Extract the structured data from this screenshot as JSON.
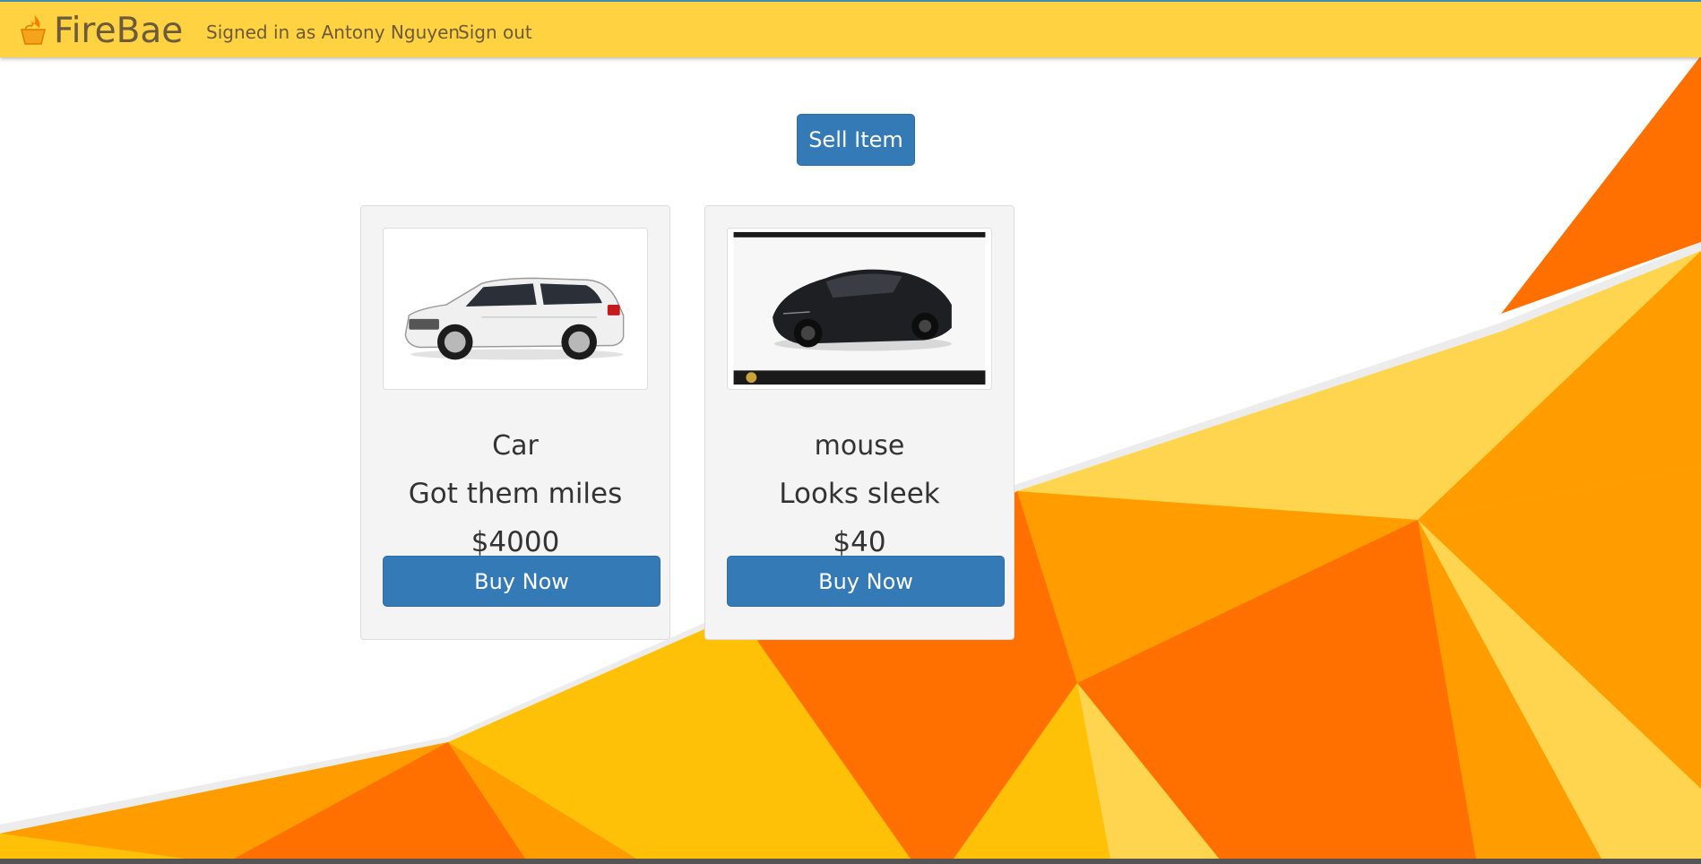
{
  "colors": {
    "navbar": "#ffd242",
    "navbar_border": "#3f8fb4",
    "button_primary": "#337ab7",
    "card_bg": "#f4f4f4",
    "poly_orange_dark": "#ff7000",
    "poly_orange": "#ff9d00",
    "poly_yellow": "#ffc107",
    "poly_yellow_light": "#ffd54f"
  },
  "navbar": {
    "brand": "FireBae",
    "brand_icon": "fire-basket-icon",
    "signed_in_text": "Signed in as Antony Nguyen",
    "signout_label": "Sign out"
  },
  "main": {
    "sell_button_label": "Sell Item"
  },
  "items": [
    {
      "image_icon": "white-suv-image",
      "title": "Car",
      "description": "Got them miles",
      "price": "$4000",
      "buy_label": "Buy Now"
    },
    {
      "image_icon": "black-sports-car-image",
      "title": "mouse",
      "description": "Looks sleek",
      "price": "$40",
      "buy_label": "Buy Now"
    }
  ]
}
